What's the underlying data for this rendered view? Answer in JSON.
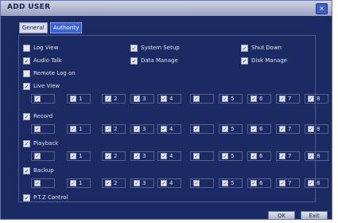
{
  "window": {
    "title": "ADD USER",
    "close_label": "×"
  },
  "tabs": [
    {
      "label": "General"
    },
    {
      "label": "Authority"
    }
  ],
  "permissions": {
    "log_view": {
      "label": "Log View",
      "checked": false
    },
    "system_setup": {
      "label": "System Setup",
      "checked": true
    },
    "shut_down": {
      "label": "Shut Down",
      "checked": true
    },
    "audio_talk": {
      "label": "Audio Talk",
      "checked": true
    },
    "data_manage": {
      "label": "Data Manage",
      "checked": true
    },
    "disk_manage": {
      "label": "Disk Manage",
      "checked": true
    },
    "remote_log_on": {
      "label": "Remote Log on",
      "checked": false
    }
  },
  "groups": [
    {
      "label": "Live View",
      "checked": true
    },
    {
      "label": "Record",
      "checked": true
    },
    {
      "label": "Playback",
      "checked": true
    },
    {
      "label": "Backup",
      "checked": true
    }
  ],
  "channel_labels": [
    "",
    "1",
    "2",
    "3",
    "4",
    "",
    "5",
    "6",
    "7",
    "8"
  ],
  "ptz": {
    "label": "P.T.Z Control",
    "checked": true
  },
  "buttons": {
    "ok": "OK",
    "exit": "Exit"
  }
}
